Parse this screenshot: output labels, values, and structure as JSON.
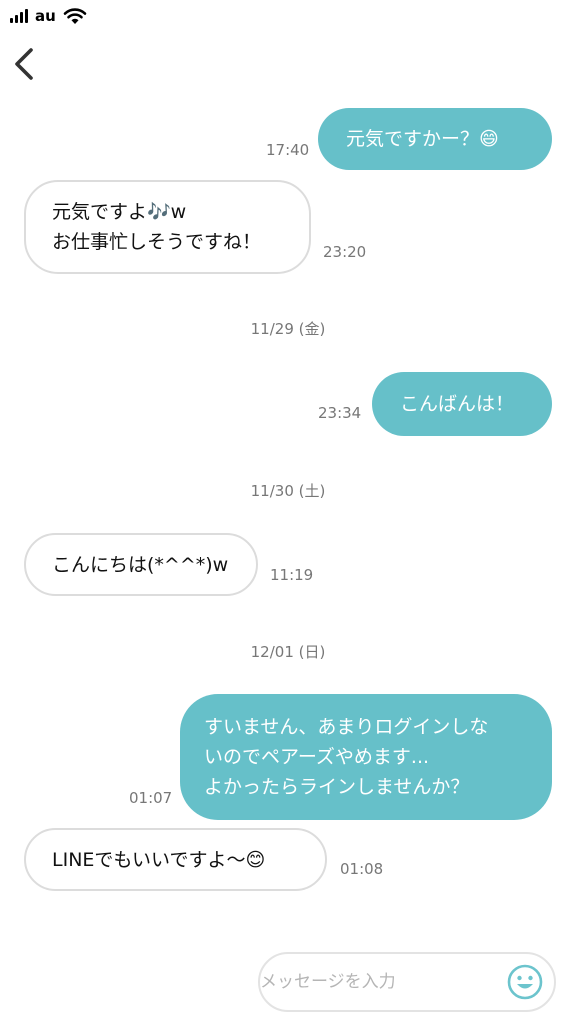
{
  "status_bar": {
    "carrier": "au",
    "icons": [
      "signal-bars-icon",
      "wifi-icon"
    ]
  },
  "nav": {
    "back_icon": "chevron-left-icon"
  },
  "messages": [
    {
      "direction": "outgoing",
      "text": "元気ですかー？😄",
      "time": "17:40"
    },
    {
      "direction": "incoming",
      "text": "元気ですよ🎶w\nお仕事忙しそうですね！",
      "time": "23:20"
    },
    {
      "direction": "outgoing",
      "text": "こんばんは！",
      "time": "23:34"
    },
    {
      "direction": "incoming",
      "text": "こんにちは(*^^*)w",
      "time": "11:19"
    },
    {
      "direction": "outgoing",
      "text": "すいません、あまりログインしな\nいのでペアーズやめます...\nよかったらラインしませんか？",
      "time": "01:07"
    },
    {
      "direction": "incoming",
      "text": "LINEでもいいですよ〜😊",
      "time": "01:08"
    }
  ],
  "dates": [
    "11/29 (金)",
    "11/30 (土)",
    "12/01 (日)"
  ],
  "input": {
    "placeholder": "メッセージを入力",
    "value": "",
    "emoji_icon": "smiley-face-icon"
  },
  "colors": {
    "outgoing_bubble": "#66c0c9",
    "incoming_border": "#dcdcdc",
    "meta_text": "#777777"
  }
}
